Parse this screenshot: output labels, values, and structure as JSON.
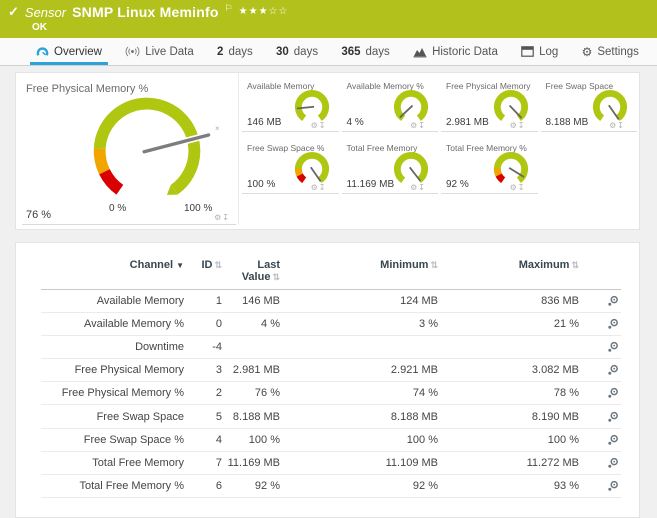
{
  "colors": {
    "lime": "#b3c11d",
    "gauge_green": "#b0c711",
    "warn": "#f0a500",
    "alert": "#d90000",
    "accent_blue": "#2aa2dc"
  },
  "header": {
    "type_label": "Sensor",
    "title": "SNMP Linux Meminfo",
    "status": "OK",
    "stars_filled": 3,
    "stars_total": 5
  },
  "tabs": {
    "overview": {
      "label": "Overview"
    },
    "live_data": {
      "label": "Live Data"
    },
    "days2": {
      "num": "2",
      "unit": "days"
    },
    "days30": {
      "num": "30",
      "unit": "days"
    },
    "days365": {
      "num": "365",
      "unit": "days"
    },
    "historic": {
      "label": "Historic Data"
    },
    "log": {
      "label": "Log"
    },
    "settings": {
      "label": "Settings"
    }
  },
  "main_gauge": {
    "title": "Free Physical Memory %",
    "value": "76 %",
    "scale_min": "0 %",
    "scale_max": "100 %",
    "percent": 76
  },
  "small_gauges": [
    {
      "title": "Available Memory",
      "value": "146 MB",
      "percent": 17,
      "warning_segments": false
    },
    {
      "title": "Available Memory %",
      "value": "4 %",
      "percent": 4,
      "warning_segments": false
    },
    {
      "title": "Free Physical Memory",
      "value": "2.981 MB",
      "percent": 97,
      "warning_segments": false
    },
    {
      "title": "Free Swap Space",
      "value": "8.188 MB",
      "percent": 100,
      "warning_segments": false
    },
    {
      "title": "Free Swap Space %",
      "value": "100 %",
      "percent": 100,
      "warning_segments": true
    },
    {
      "title": "Total Free Memory",
      "value": "11.169 MB",
      "percent": 99,
      "warning_segments": false
    },
    {
      "title": "Total Free Memory %",
      "value": "92 %",
      "percent": 92,
      "warning_segments": true
    }
  ],
  "table": {
    "headers": {
      "channel": "Channel",
      "id": "ID",
      "last": "Last Value",
      "min": "Minimum",
      "max": "Maximum"
    },
    "rows": [
      {
        "channel": "Available Memory",
        "id": "1",
        "last": "146 MB",
        "min": "124 MB",
        "max": "836 MB"
      },
      {
        "channel": "Available Memory %",
        "id": "0",
        "last": "4 %",
        "min": "3 %",
        "max": "21 %"
      },
      {
        "channel": "Downtime",
        "id": "-4",
        "last": "",
        "min": "",
        "max": ""
      },
      {
        "channel": "Free Physical Memory",
        "id": "3",
        "last": "2.981 MB",
        "min": "2.921 MB",
        "max": "3.082 MB"
      },
      {
        "channel": "Free Physical Memory %",
        "id": "2",
        "last": "76 %",
        "min": "74 %",
        "max": "78 %"
      },
      {
        "channel": "Free Swap Space",
        "id": "5",
        "last": "8.188 MB",
        "min": "8.188 MB",
        "max": "8.190 MB"
      },
      {
        "channel": "Free Swap Space %",
        "id": "4",
        "last": "100 %",
        "min": "100 %",
        "max": "100 %"
      },
      {
        "channel": "Total Free Memory",
        "id": "7",
        "last": "11.169 MB",
        "min": "11.109 MB",
        "max": "11.272 MB"
      },
      {
        "channel": "Total Free Memory %",
        "id": "6",
        "last": "92 %",
        "min": "92 %",
        "max": "93 %"
      }
    ]
  }
}
